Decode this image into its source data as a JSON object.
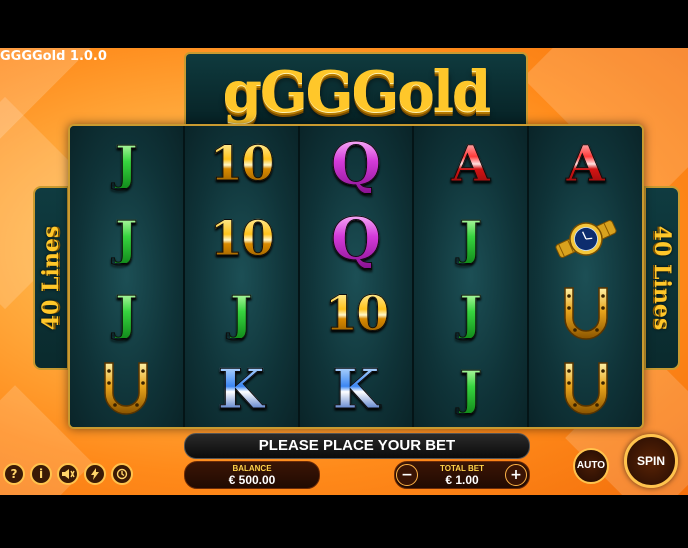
{
  "game": {
    "version_label": "GGGGold 1.0.0",
    "logo_text": "gGGGold",
    "lines_label": "40 Lines"
  },
  "reels": [
    [
      "J",
      "J",
      "J",
      "horseshoe"
    ],
    [
      "10",
      "10",
      "J",
      "K"
    ],
    [
      "Q",
      "Q",
      "10",
      "K"
    ],
    [
      "A",
      "J",
      "J",
      "J"
    ],
    [
      "A",
      "watch",
      "horseshoe",
      "horseshoe"
    ]
  ],
  "message": "PLEASE PLACE YOUR BET",
  "balance": {
    "label": "BALANCE",
    "value": "€ 500.00"
  },
  "total_bet": {
    "label": "TOTAL BET",
    "value": "€ 1.00",
    "minus": "−",
    "plus": "+"
  },
  "buttons": {
    "auto": "AUTO",
    "spin": "SPIN"
  },
  "utility_icons": [
    "help-icon",
    "info-icon",
    "sound-icon",
    "turbo-icon",
    "history-icon"
  ],
  "colors": {
    "accent_gold": "#ffc72a",
    "panel_teal": "#0f3a3e",
    "background_orange": "#ff8a1a"
  }
}
